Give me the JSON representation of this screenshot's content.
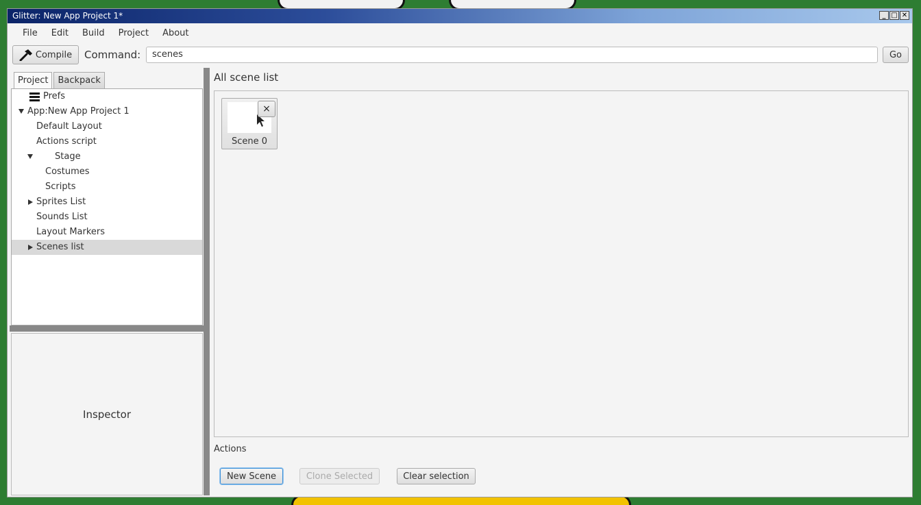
{
  "window": {
    "title": "Glitter: New App Project 1*"
  },
  "menu": [
    "File",
    "Edit",
    "Build",
    "Project",
    "About"
  ],
  "toolbar": {
    "compile_label": "Compile",
    "command_label": "Command:",
    "command_value": "scenes",
    "go_label": "Go"
  },
  "left_tabs": [
    "Project",
    "Backpack"
  ],
  "tree": [
    {
      "label": "Prefs"
    },
    {
      "label": "App:New App Project 1"
    },
    {
      "label": "Default Layout"
    },
    {
      "label": "Actions script"
    },
    {
      "label": "Stage"
    },
    {
      "label": "Costumes"
    },
    {
      "label": "Scripts"
    },
    {
      "label": "Sprites List"
    },
    {
      "label": "Sounds List"
    },
    {
      "label": "Layout Markers"
    },
    {
      "label": "Scenes list"
    }
  ],
  "inspector": {
    "label": "Inspector"
  },
  "scenes": {
    "title": "All scene list",
    "items": [
      {
        "name": "Scene 0",
        "close_label": "×"
      }
    ]
  },
  "actions": {
    "label": "Actions",
    "new_scene": "New Scene",
    "clone_selected": "Clone Selected",
    "clear_selection": "Clear selection"
  }
}
